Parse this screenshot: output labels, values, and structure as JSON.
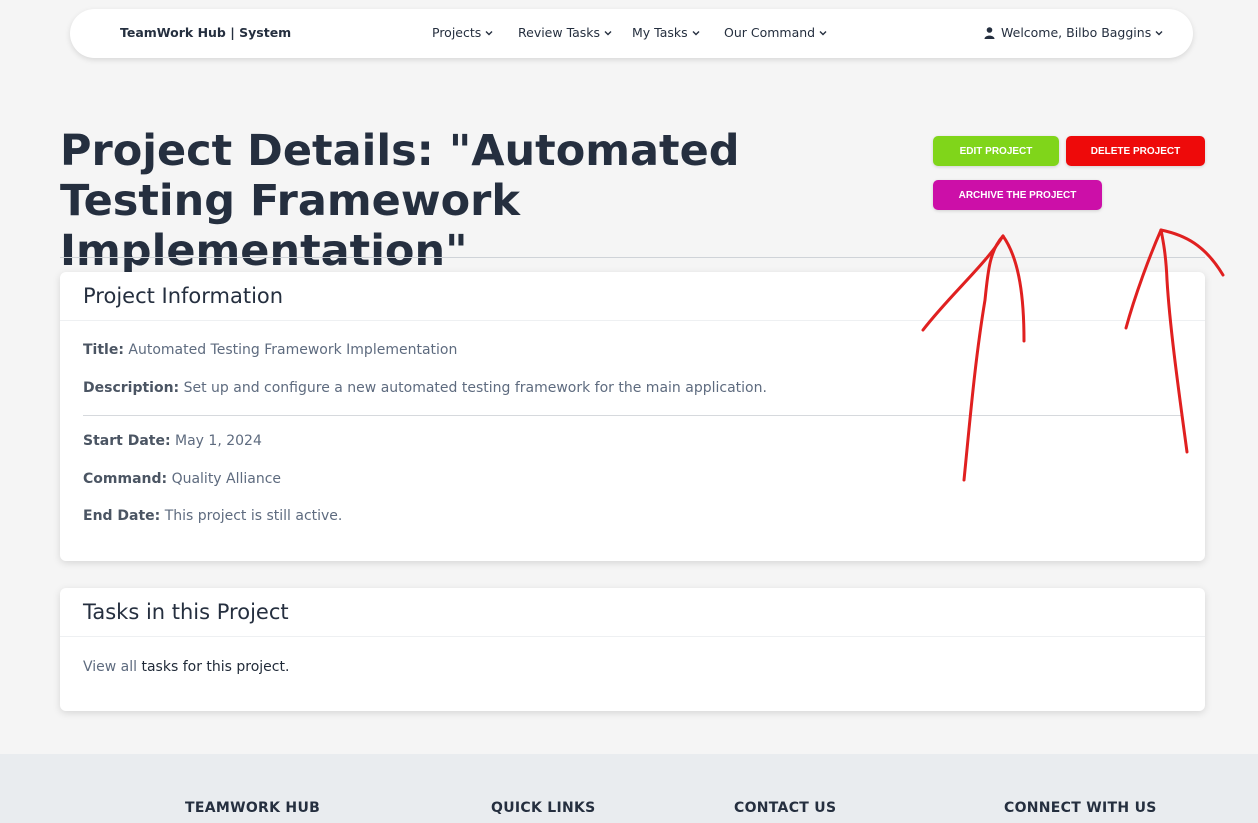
{
  "nav": {
    "brand": "TeamWork Hub | System",
    "items": [
      {
        "label": "Projects"
      },
      {
        "label": "Review Tasks"
      },
      {
        "label": "My Tasks"
      },
      {
        "label": "Our Command"
      }
    ],
    "user": "Welcome, Bilbo Baggins"
  },
  "header": {
    "title": "Project Details: \"Automated Testing Framework Implementation\"",
    "edit_label": "Edit Project",
    "delete_label": "Delete Project",
    "archive_label": "Archive the Project"
  },
  "info": {
    "heading": "Project Information",
    "title_label": "Title:",
    "title_value": "Automated Testing Framework Implementation",
    "desc_label": "Description:",
    "desc_value": "Set up and configure a new automated testing framework for the main application.",
    "start_label": "Start Date:",
    "start_value": "May 1, 2024",
    "command_label": "Command:",
    "command_value": "Quality Alliance",
    "end_label": "End Date:",
    "end_value": "This project is still active."
  },
  "tasks": {
    "heading": "Tasks in this Project",
    "view_all": "View all",
    "suffix": "tasks for this project."
  },
  "footer": {
    "col1": "TEAMWORK HUB",
    "col2": "QUICK LINKS",
    "col3": "CONTACT US",
    "col4": "CONNECT WITH US"
  },
  "colors": {
    "edit": "#80d51a",
    "delete": "#ee0a0a",
    "archive": "#cc0fa8",
    "annotation": "#e02020"
  }
}
